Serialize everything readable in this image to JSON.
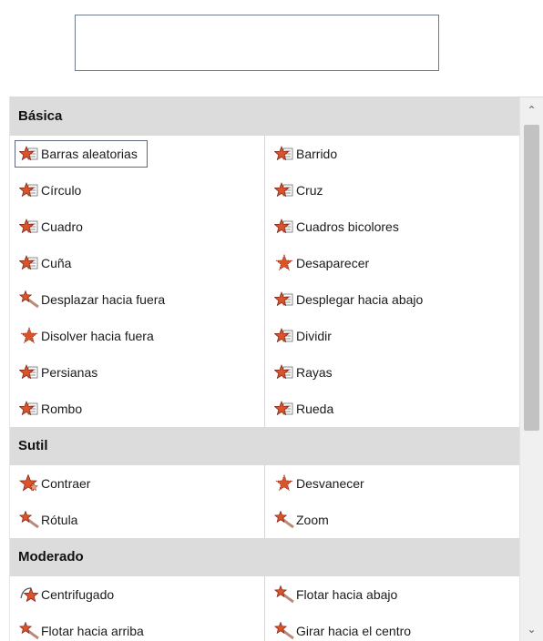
{
  "sections": [
    {
      "title": "Básica",
      "items": [
        {
          "label": "Barras aleatorias",
          "icon": "effect-star-page-icon",
          "selected": true
        },
        {
          "label": "Barrido",
          "icon": "effect-star-page-icon"
        },
        {
          "label": "Círculo",
          "icon": "effect-star-page-icon"
        },
        {
          "label": "Cruz",
          "icon": "effect-star-page-icon"
        },
        {
          "label": "Cuadro",
          "icon": "effect-star-page-icon"
        },
        {
          "label": "Cuadros bicolores",
          "icon": "effect-star-page-icon"
        },
        {
          "label": "Cuña",
          "icon": "effect-star-page-icon"
        },
        {
          "label": "Desaparecer",
          "icon": "effect-star-dotted-icon"
        },
        {
          "label": "Desplazar hacia fuera",
          "icon": "effect-star-swoosh-icon"
        },
        {
          "label": "Desplegar hacia abajo",
          "icon": "effect-star-page-icon"
        },
        {
          "label": "Disolver hacia fuera",
          "icon": "effect-star-dotted-icon"
        },
        {
          "label": "Dividir",
          "icon": "effect-star-page-icon"
        },
        {
          "label": "Persianas",
          "icon": "effect-star-page-icon"
        },
        {
          "label": "Rayas",
          "icon": "effect-star-page-icon"
        },
        {
          "label": "Rombo",
          "icon": "effect-star-page-icon"
        },
        {
          "label": "Rueda",
          "icon": "effect-star-page-icon"
        }
      ]
    },
    {
      "title": "Sutil",
      "items": [
        {
          "label": "Contraer",
          "icon": "effect-star-shrink-icon"
        },
        {
          "label": "Desvanecer",
          "icon": "effect-star-dotted-icon"
        },
        {
          "label": "Rótula",
          "icon": "effect-star-swoosh-icon"
        },
        {
          "label": "Zoom",
          "icon": "effect-star-swoosh-icon"
        }
      ]
    },
    {
      "title": "Moderado",
      "items": [
        {
          "label": "Centrifugado",
          "icon": "effect-star-spin-icon"
        },
        {
          "label": "Flotar hacia abajo",
          "icon": "effect-star-swoosh-icon"
        },
        {
          "label": "Flotar hacia arriba",
          "icon": "effect-star-swoosh-icon"
        },
        {
          "label": "Girar hacia el centro",
          "icon": "effect-star-swoosh-icon"
        }
      ]
    }
  ],
  "colors": {
    "star": "#d9542b",
    "star_dark": "#7a1e10",
    "section_bg": "#dcdcdc",
    "page_icon": "#8a8a8a"
  }
}
